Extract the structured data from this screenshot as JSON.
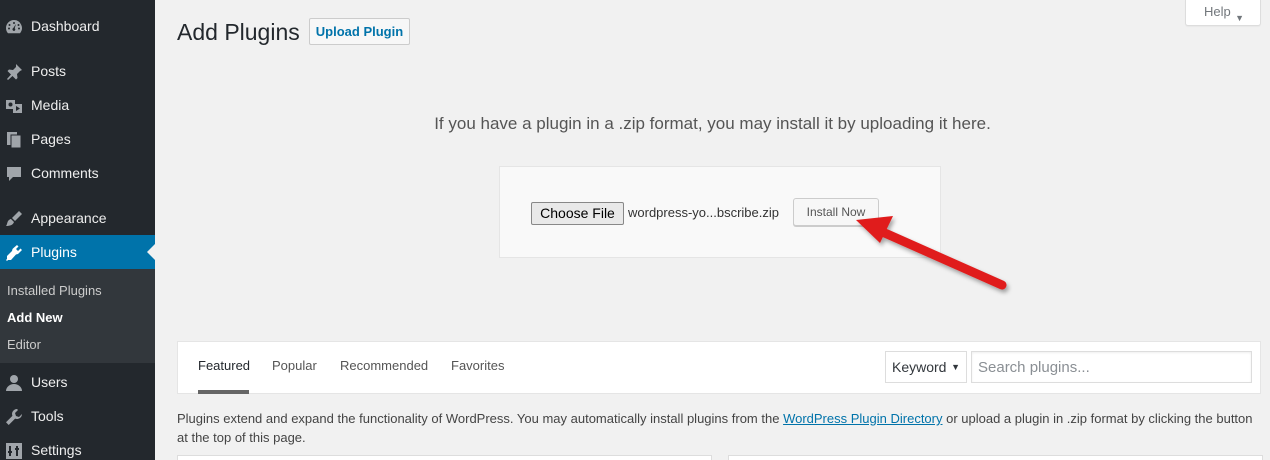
{
  "sidebar": {
    "items": [
      {
        "label": "Dashboard",
        "icon": "dashboard-icon"
      },
      {
        "label": "Posts",
        "icon": "pin-icon"
      },
      {
        "label": "Media",
        "icon": "media-icon"
      },
      {
        "label": "Pages",
        "icon": "pages-icon"
      },
      {
        "label": "Comments",
        "icon": "comment-icon"
      },
      {
        "label": "Appearance",
        "icon": "brush-icon"
      },
      {
        "label": "Plugins",
        "icon": "plugin-icon"
      },
      {
        "label": "Users",
        "icon": "user-icon"
      },
      {
        "label": "Tools",
        "icon": "wrench-icon"
      },
      {
        "label": "Settings",
        "icon": "settings-icon"
      }
    ],
    "submenu": [
      {
        "label": "Installed Plugins"
      },
      {
        "label": "Add New"
      },
      {
        "label": "Editor"
      }
    ]
  },
  "header": {
    "title": "Add Plugins",
    "upload_button": "Upload Plugin",
    "help_label": "Help",
    "help_caret": "▼"
  },
  "upload": {
    "message": "If you have a plugin in a .zip format, you may install it by uploading it here.",
    "choose_file": "Choose File",
    "file_name": "wordpress-yo...bscribe.zip",
    "install_button": "Install Now"
  },
  "filter": {
    "tabs": [
      "Featured",
      "Popular",
      "Recommended",
      "Favorites"
    ],
    "keyword_select": "Keyword",
    "select_caret": "▼",
    "search_placeholder": "Search plugins..."
  },
  "description": {
    "before": "Plugins extend and expand the functionality of WordPress. You may automatically install plugins from the ",
    "link": "WordPress Plugin Directory",
    "after": " or upload a plugin in .zip format by clicking the button at the top of this page."
  },
  "colors": {
    "sidebar_bg": "#23282d",
    "active_bg": "#0073aa",
    "link": "#0073aa",
    "arrow": "#e01b1b"
  }
}
